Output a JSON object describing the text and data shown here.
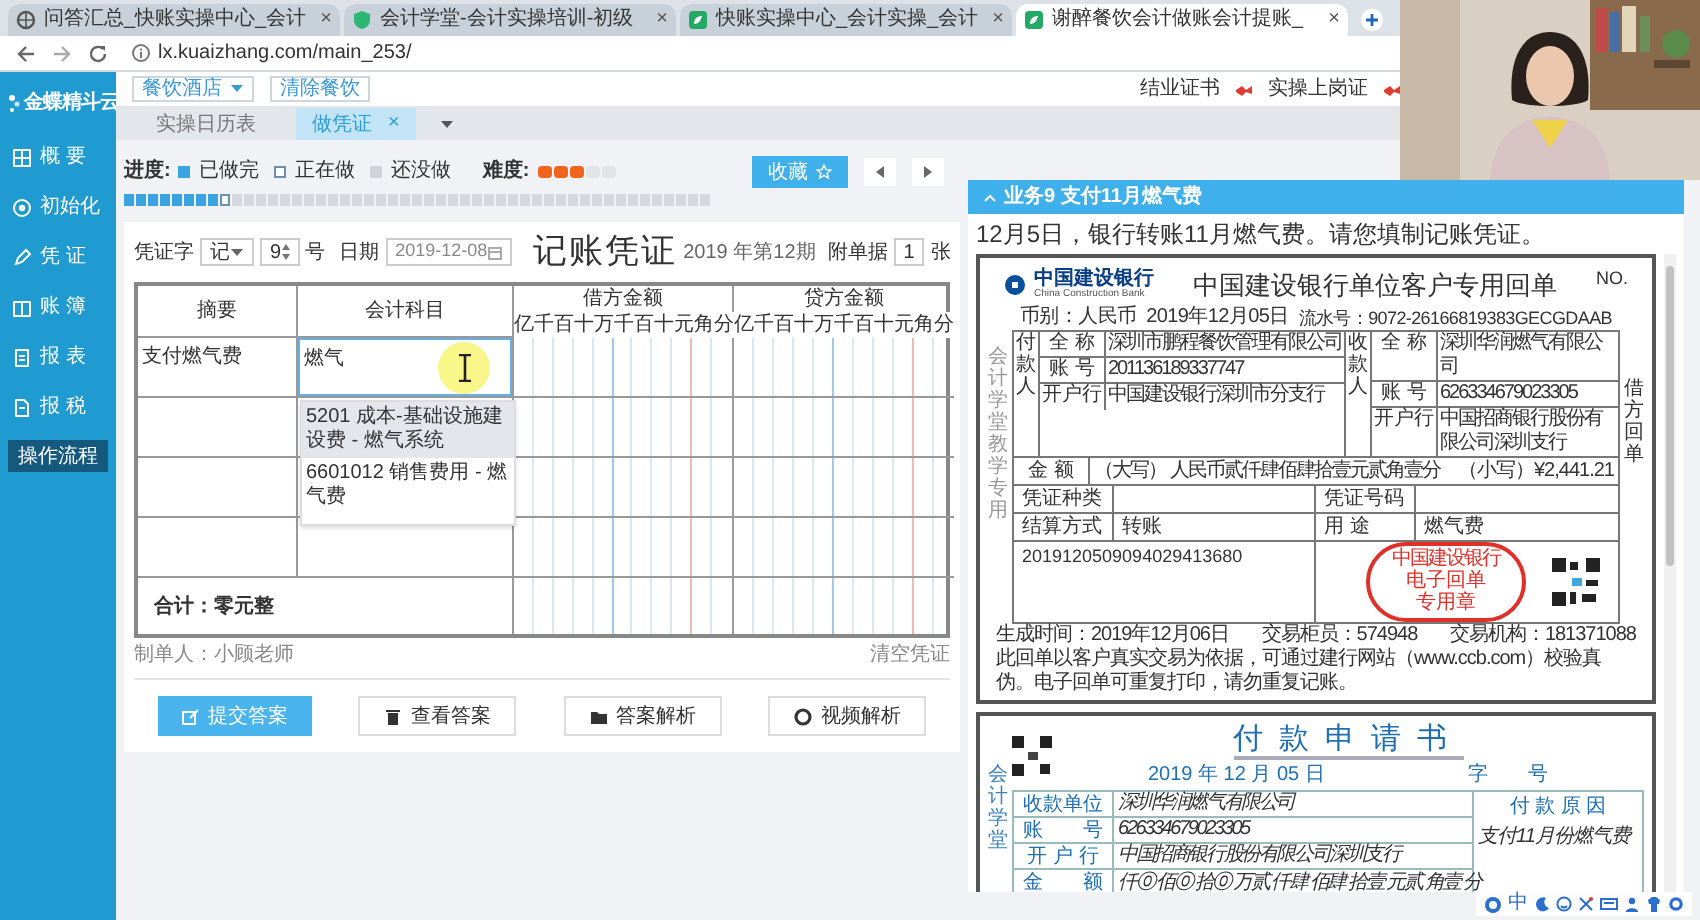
{
  "browser": {
    "tabs": [
      {
        "title": "问答汇总_快账实操中心_会计",
        "close": "×",
        "selected": false
      },
      {
        "title": "会计学堂-会计实操培训-初级",
        "close": "×",
        "selected": false
      },
      {
        "title": "快账实操中心_会计实操_会计",
        "close": "×",
        "selected": false
      },
      {
        "title": "谢醉餐饮会计做账会计提账_",
        "close": "×",
        "selected": true
      }
    ],
    "address": "lx.kuaizhang.com/main_253/"
  },
  "sidebar": {
    "logo": "金蝶精斗云",
    "items": [
      "概 要",
      "初始化",
      "凭 证",
      "账 簿",
      "报 表",
      "报 税"
    ],
    "flow_button": "操作流程"
  },
  "topbar": {
    "industry": "餐饮酒店",
    "clear": "清除餐饮",
    "links": [
      "结业证书",
      "实操上岗证"
    ]
  },
  "tabs": [
    {
      "label": "实操日历表",
      "selected": false
    },
    {
      "label": "做凭证",
      "close": "×",
      "selected": true
    }
  ],
  "progress": {
    "label": "进度:",
    "legend": [
      {
        "label": "已做完",
        "kind": "done"
      },
      {
        "label": "正在做",
        "kind": "current"
      },
      {
        "label": "还没做",
        "kind": "todo"
      }
    ],
    "difficulty_label": "难度:",
    "stars": 3,
    "level": 0.17
  },
  "favorite_button": "收藏",
  "voucher": {
    "word_label": "凭证字",
    "word": "记",
    "number": "9",
    "number_suffix": "号",
    "date_label": "日期",
    "date": "2019-12-08",
    "title": "记账凭证",
    "period": "2019 年第12期",
    "attach_label": "附单据",
    "attach": "1",
    "attach_suffix": "张",
    "columns": [
      "摘要",
      "会计科目",
      "借方金额",
      "贷方金额"
    ],
    "debit_digits": [
      "亿",
      "千",
      "百",
      "十",
      "万",
      "千",
      "百",
      "十",
      "元",
      "角",
      "分"
    ],
    "credit_digits": [
      "亿",
      "千",
      "百",
      "十",
      "万",
      "千",
      "百",
      "十",
      "元",
      "角",
      "分"
    ],
    "rows": [
      {
        "summary": "支付燃气费",
        "account": "燃气"
      }
    ],
    "suggestions": [
      {
        "label": "5201 成本-基础设施建设费 - 燃气系统",
        "selected": true
      },
      {
        "label": "6601012 销售费用 - 燃气费",
        "selected": false
      }
    ],
    "total": "合计：零元整",
    "maker": "制单人：小顾老师",
    "clear": "清空凭证"
  },
  "actions": [
    {
      "label": "提交答案",
      "primary": true
    },
    {
      "label": "查看答案",
      "primary": false
    },
    {
      "label": "答案解析",
      "primary": false
    },
    {
      "label": "视频解析",
      "primary": false
    }
  ],
  "task": {
    "title": "业务9 支付11月燃气费",
    "description": "12月5日，银行转账11月燃气费。请您填制记账凭证。"
  },
  "receipt": {
    "bank_name": "中国建设银行",
    "bank_name_en": "China Construction Bank",
    "title": "中国建设银行单位客户专用回单",
    "no_label": "NO.",
    "currency": "币别：人民币",
    "date": "2019年12月05日",
    "serial": "流水号：9072-26166819383GECGDAAB",
    "payer_label": "付款人",
    "payee_label": "收款人",
    "payer": [
      {
        "label": "全 称",
        "value": "深圳市鹏程餐饮管理有限公司"
      },
      {
        "label": "账 号",
        "value": "201136189337747"
      },
      {
        "label": "开户行",
        "value": "中国建设银行深圳市分支行"
      }
    ],
    "payee": [
      {
        "label": "全 称",
        "value": "深圳华润燃气有限公司"
      },
      {
        "label": "账 号",
        "value": "626334679023305"
      },
      {
        "label": "开户行",
        "value": "中国招商银行股份有限公司深圳支行"
      }
    ],
    "amount_label": "金 额",
    "amount_words": "（大写） 人民币贰仟肆佰肆拾壹元贰角壹分",
    "amount_figures": "（小写）¥2,441.21",
    "voucher_type_label": "凭证种类",
    "voucher_no_label": "凭证号码",
    "settlement_label": "结算方式",
    "settlement": "转账",
    "purpose_label": "用 途",
    "purpose": "燃气费",
    "reference": "2019120509094029413680",
    "stamp": [
      "中国建设银行",
      "电子回单",
      "专用章"
    ],
    "side_left": "会计学堂教学专用",
    "side_right": "借方回单",
    "generated": "生成时间：2019年12月06日",
    "teller": "交易柜员：574948",
    "branch": "交易机构：181371088",
    "note": "此回单以客户真实交易为依据，可通过建行网站（www.ccb.com）校验真伪。电子回单可重复打印，请勿重复记账。"
  },
  "payment_request": {
    "title": "付款申请书",
    "date": "2019 年 12 月 05 日",
    "number": "字　　号",
    "rows": [
      {
        "label": "收款单位",
        "value": "深圳华润燃气有限公司"
      },
      {
        "label": "账　　号",
        "value": "626334679023305"
      },
      {
        "label": "开 户 行",
        "value": "中国招商银行股份有限公司深圳支行"
      },
      {
        "label": "金　　额",
        "value": "仟⓪ 佰⓪ 拾⓪ 万贰 仟肆 佰肆 拾壹 元贰 角壹 分"
      }
    ],
    "reason_label": "付 款 原 因",
    "reason": "支付11月份燃气费",
    "side": "会计学堂"
  },
  "tray": {
    "ime": "中"
  }
}
